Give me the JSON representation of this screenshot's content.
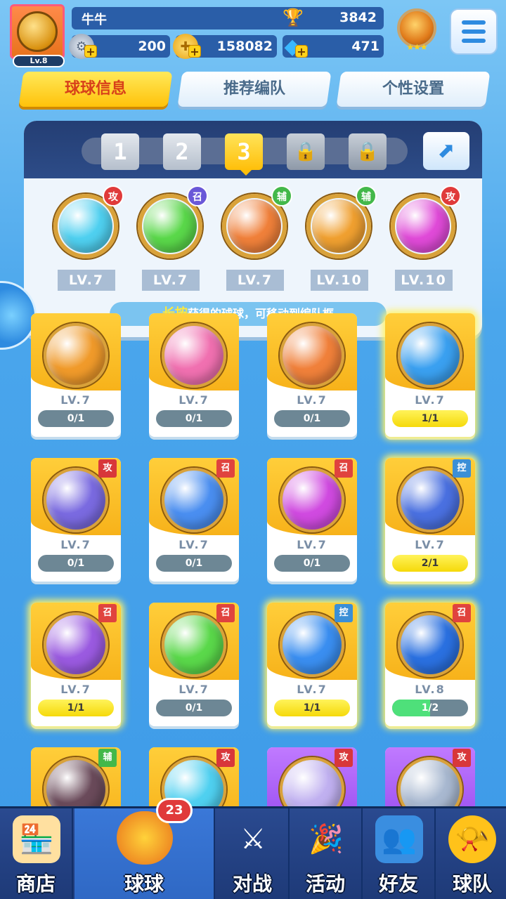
{
  "player": {
    "name": "牛牛",
    "level": "Lv.8",
    "trophies": "3842",
    "silver": "200",
    "gold": "158082",
    "gems": "471"
  },
  "tabs": [
    {
      "label": "球球信息",
      "active": true
    },
    {
      "label": "推荐编队",
      "active": false
    },
    {
      "label": "个性设置",
      "active": false
    }
  ],
  "team_slots": {
    "slot1": "1",
    "slot2": "2",
    "slot3": "3",
    "selected": "3"
  },
  "team": [
    {
      "icon": "arrow-ball-icon",
      "tag": "攻",
      "level": "LV.7",
      "color": "#4fd0f0"
    },
    {
      "icon": "star-ball-icon",
      "tag": "召",
      "level": "LV.7",
      "color": "#5ad84a"
    },
    {
      "icon": "phoenix-ball-icon",
      "tag": "辅",
      "level": "LV.7",
      "color": "#f0803a"
    },
    {
      "icon": "pumpkin-ball-icon",
      "tag": "辅",
      "level": "LV.10",
      "color": "#f0a030"
    },
    {
      "icon": "shield-ball-icon",
      "tag": "攻",
      "level": "LV.10",
      "color": "#e04ad8"
    }
  ],
  "hint": {
    "highlight": "长按",
    "text": "获得的球球，可移动到编队框"
  },
  "cards": [
    {
      "icon": "helmet-ball-icon",
      "tag": "",
      "level": "LV.7",
      "progress": "0/1",
      "state": "empty",
      "color": "#f09a2a",
      "style": "yellow"
    },
    {
      "icon": "heart-ball-icon",
      "tag": "",
      "level": "LV.7",
      "progress": "0/1",
      "state": "empty",
      "color": "#f070b0",
      "style": "yellow"
    },
    {
      "icon": "phoenix-ball-icon",
      "tag": "",
      "level": "LV.7",
      "progress": "0/1",
      "state": "empty",
      "color": "#f0803a",
      "style": "yellow"
    },
    {
      "icon": "cloud-ball-icon",
      "tag": "",
      "level": "LV.7",
      "progress": "1/1",
      "state": "full",
      "color": "#3aa0f0",
      "style": "yellow"
    },
    {
      "icon": "maze-ball-icon",
      "tag": "攻",
      "level": "LV.7",
      "progress": "0/1",
      "state": "empty",
      "color": "#7a6ae0",
      "style": "yellow"
    },
    {
      "icon": "vortex-ball-icon",
      "tag": "召",
      "level": "LV.7",
      "progress": "0/1",
      "state": "empty",
      "color": "#4a8ef0",
      "style": "yellow"
    },
    {
      "icon": "mushroom-ball-icon",
      "tag": "召",
      "level": "LV.7",
      "progress": "0/1",
      "state": "empty",
      "color": "#d04ae0",
      "style": "yellow"
    },
    {
      "icon": "clock-ball-icon",
      "tag": "控",
      "level": "LV.7",
      "progress": "2/1",
      "state": "full",
      "color": "#4a70e0",
      "style": "yellow"
    },
    {
      "icon": "orbit-ball-icon",
      "tag": "召",
      "level": "LV.7",
      "progress": "1/1",
      "state": "full",
      "color": "#9a5ae0",
      "style": "yellow"
    },
    {
      "icon": "star-ball-icon",
      "tag": "召",
      "level": "LV.7",
      "progress": "0/1",
      "state": "empty",
      "color": "#5ad84a",
      "style": "yellow"
    },
    {
      "icon": "snowflake-ball-icon",
      "tag": "控",
      "level": "LV.7",
      "progress": "1/1",
      "state": "full",
      "color": "#3a8ef0",
      "style": "yellow"
    },
    {
      "icon": "ice-ball-icon",
      "tag": "召",
      "level": "LV.8",
      "progress": "1/2",
      "state": "partial",
      "fill": 0.5,
      "color": "#2a70e0",
      "style": "yellow"
    },
    {
      "icon": "skull-ball-icon",
      "tag": "辅",
      "level": "",
      "progress": "",
      "state": "none",
      "color": "#6a4a5a",
      "style": "yellow"
    },
    {
      "icon": "arrow-ball-icon",
      "tag": "攻",
      "level": "",
      "progress": "",
      "state": "none",
      "color": "#4fd0f0",
      "style": "yellow"
    },
    {
      "icon": "bubble-ball-icon",
      "tag": "攻",
      "level": "",
      "progress": "",
      "state": "none",
      "color": "#c0b0f0",
      "style": "purple"
    },
    {
      "icon": "fan-ball-icon",
      "tag": "攻",
      "level": "",
      "progress": "",
      "state": "none",
      "color": "#a8b8d0",
      "style": "purple"
    }
  ],
  "nav": [
    {
      "label": "商店",
      "icon": "shop-icon"
    },
    {
      "label": "球球",
      "icon": "ball-bucket-icon",
      "badge": "23"
    },
    {
      "label": "对战",
      "icon": "crossed-swords-icon"
    },
    {
      "label": "活动",
      "icon": "party-popper-icon"
    },
    {
      "label": "好友",
      "icon": "friends-book-icon"
    },
    {
      "label": "球队",
      "icon": "whistle-icon"
    }
  ]
}
